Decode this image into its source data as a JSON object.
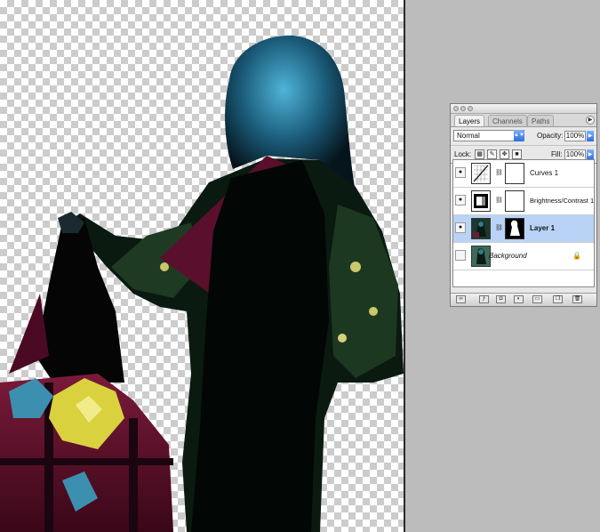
{
  "canvas": {
    "description_free": true
  },
  "layers_panel": {
    "tabs": [
      {
        "label": "Layers",
        "active": true
      },
      {
        "label": "Channels",
        "active": false
      },
      {
        "label": "Paths",
        "active": false
      }
    ],
    "blend_mode": "Normal",
    "opacity_label": "Opacity:",
    "opacity_value": "100%",
    "lock_label": "Lock:",
    "fill_label": "Fill:",
    "fill_value": "100%",
    "layers": [
      {
        "name": "Curves 1",
        "selected": false,
        "visible": true
      },
      {
        "name": "Brightness/Contrast 1",
        "selected": false,
        "visible": true
      },
      {
        "name": "Layer 1",
        "selected": true,
        "visible": true
      },
      {
        "name": "Background",
        "selected": false,
        "visible": false
      }
    ]
  },
  "colors": {
    "accent_blue": "#2b6fe0",
    "selected_row": "#b9d3f7",
    "workspace_gray": "#bcbcbc"
  }
}
